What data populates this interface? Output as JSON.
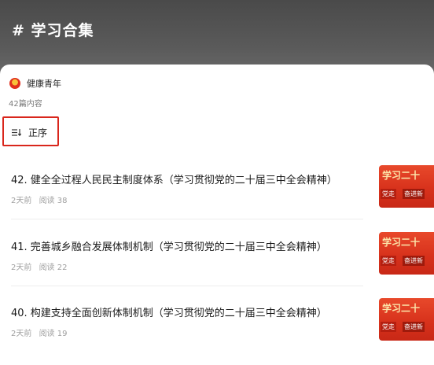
{
  "header": {
    "title": "# 学习合集"
  },
  "account": {
    "name": "健康青年",
    "count": "42篇内容"
  },
  "sort": {
    "label": "正序"
  },
  "items": [
    {
      "title": "42. 健全全过程人民民主制度体系（学习贯彻党的二十届三中全会精神）",
      "time": "2天前",
      "reads": "阅读 38",
      "thumb_top": "学习二十",
      "thumb_left": "党走",
      "thumb_right": "奋进新"
    },
    {
      "title": "41. 完善城乡融合发展体制机制（学习贯彻党的二十届三中全会精神）",
      "time": "2天前",
      "reads": "阅读 22",
      "thumb_top": "学习二十",
      "thumb_left": "党走",
      "thumb_right": "奋进新"
    },
    {
      "title": "40. 构建支持全面创新体制机制（学习贯彻党的二十届三中全会精神）",
      "time": "2天前",
      "reads": "阅读 19",
      "thumb_top": "学习二十",
      "thumb_left": "党走",
      "thumb_right": "奋进新"
    }
  ],
  "colors": {
    "accent": "#d9261c",
    "header_bg": "#555555"
  },
  "icons": {
    "sort": "sort-lines-icon",
    "logo": "account-logo-icon"
  }
}
